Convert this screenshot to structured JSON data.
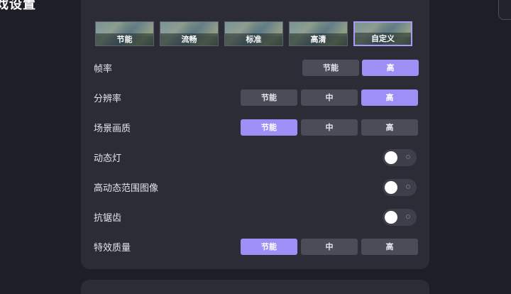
{
  "header": {
    "title": "戏设置"
  },
  "presets": [
    {
      "label": "节能",
      "selected": false
    },
    {
      "label": "流畅",
      "selected": false
    },
    {
      "label": "标准",
      "selected": false
    },
    {
      "label": "高清",
      "selected": false
    },
    {
      "label": "自定义",
      "selected": true
    }
  ],
  "settings": {
    "frame_rate": {
      "label": "帧率",
      "options": [
        "节能",
        "高"
      ],
      "selected": "高"
    },
    "resolution": {
      "label": "分辨率",
      "options": [
        "节能",
        "中",
        "高"
      ],
      "selected": "高"
    },
    "scene_quality": {
      "label": "场景画质",
      "options": [
        "节能",
        "中",
        "高"
      ],
      "selected": "节能"
    },
    "dynamic_light": {
      "label": "动态灯",
      "enabled": false
    },
    "hdr": {
      "label": "高动态范围图像",
      "enabled": false
    },
    "anti_aliasing": {
      "label": "抗锯齿",
      "enabled": false
    },
    "effects_quality": {
      "label": "特效质量",
      "options": [
        "节能",
        "中",
        "高"
      ],
      "selected": "节能"
    }
  },
  "colors": {
    "accent": "#9d8ff5",
    "background": "#1e1f26",
    "card": "#2b2c36",
    "segment": "#4a4c57"
  }
}
